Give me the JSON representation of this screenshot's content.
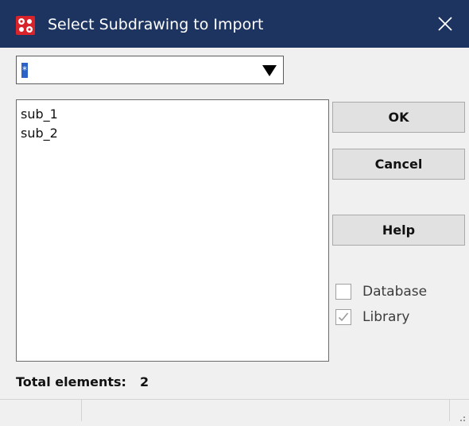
{
  "window": {
    "title": "Select Subdrawing to Import",
    "close_icon": "close-icon",
    "app_icon": "app-logo-icon"
  },
  "colors": {
    "titlebar": "#1d3461",
    "selection": "#2b62c8",
    "dialog_bg": "#f0f0f0"
  },
  "filter": {
    "value": "*",
    "arrow_icon": "dropdown-arrow-icon"
  },
  "list": {
    "items": [
      "sub_1",
      "sub_2"
    ]
  },
  "buttons": {
    "ok": "OK",
    "cancel": "Cancel",
    "help": "Help"
  },
  "options": {
    "database": {
      "label": "Database",
      "checked": false
    },
    "library": {
      "label": "Library",
      "checked": true
    }
  },
  "footer": {
    "total_label": "Total elements:",
    "total_value": "2"
  }
}
